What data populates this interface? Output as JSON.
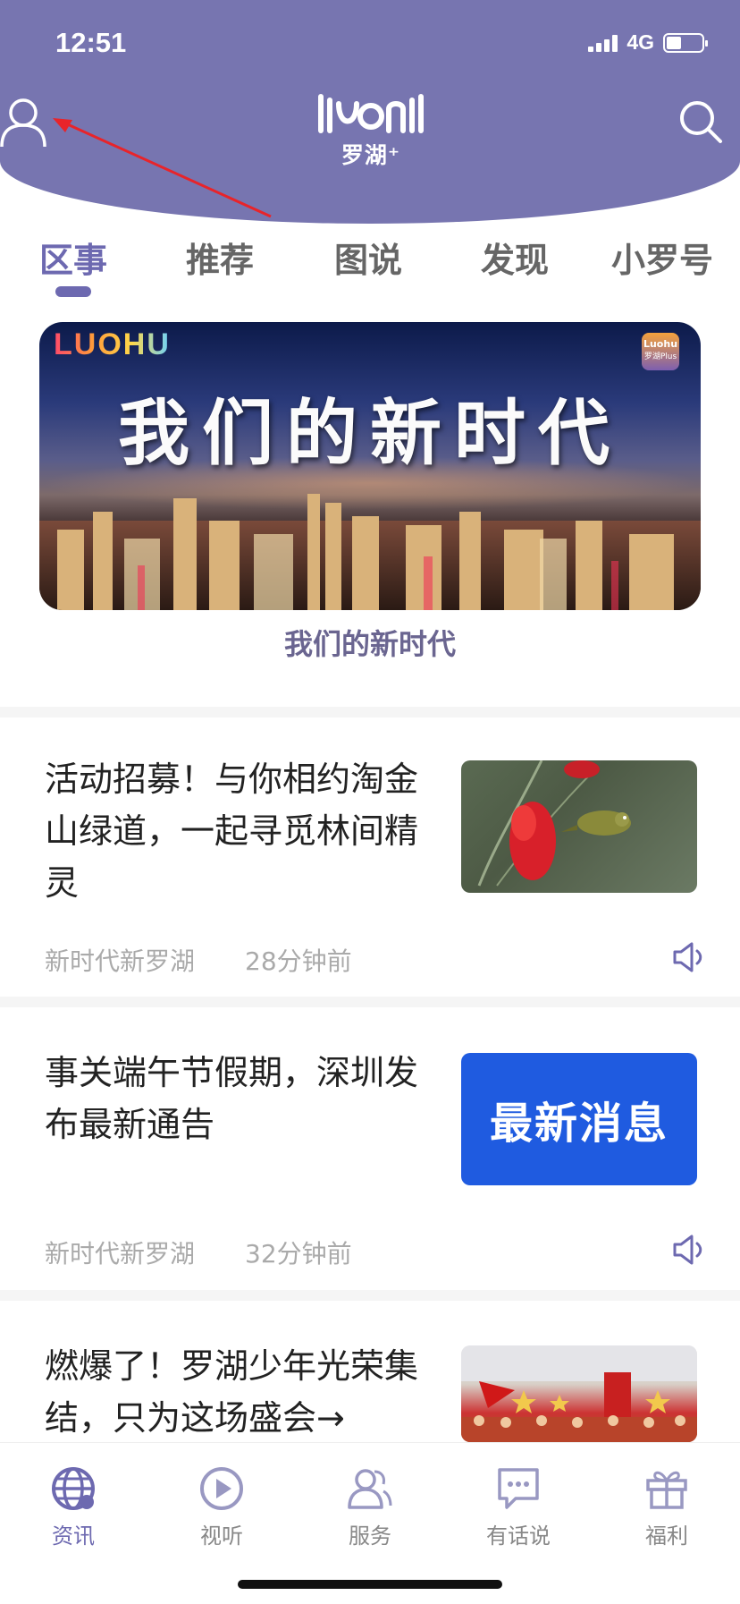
{
  "status_bar": {
    "time": "12:51",
    "network": "4G"
  },
  "header": {
    "logo_text": "罗湖⁺"
  },
  "tabs": [
    {
      "label": "区事"
    },
    {
      "label": "推荐"
    },
    {
      "label": "图说"
    },
    {
      "label": "发现"
    },
    {
      "label": "小罗号"
    }
  ],
  "banner": {
    "title": "我们的新时代",
    "brand": "LUOHU",
    "caption": "我们的新时代",
    "badge_text": "罗湖Plus"
  },
  "articles": [
    {
      "title": "活动招募！与你相约淘金山绿道，一起寻觅林间精灵",
      "source": "新时代新罗湖",
      "time": "28分钟前"
    },
    {
      "title": "事关端午节假期，深圳发布最新通告",
      "source": "新时代新罗湖",
      "time": "32分钟前",
      "thumb_text": "最新消息"
    },
    {
      "title": "燃爆了！罗湖少年光荣集结，只为这场盛会→"
    }
  ],
  "bottom_nav": [
    {
      "label": "资讯",
      "icon": "globe-icon"
    },
    {
      "label": "视听",
      "icon": "play-icon"
    },
    {
      "label": "服务",
      "icon": "people-icon"
    },
    {
      "label": "有话说",
      "icon": "chat-icon"
    },
    {
      "label": "福利",
      "icon": "gift-icon"
    }
  ],
  "colors": {
    "header": "#7775b0",
    "accent": "#6d69b0",
    "news_blue": "#1f5be0"
  }
}
